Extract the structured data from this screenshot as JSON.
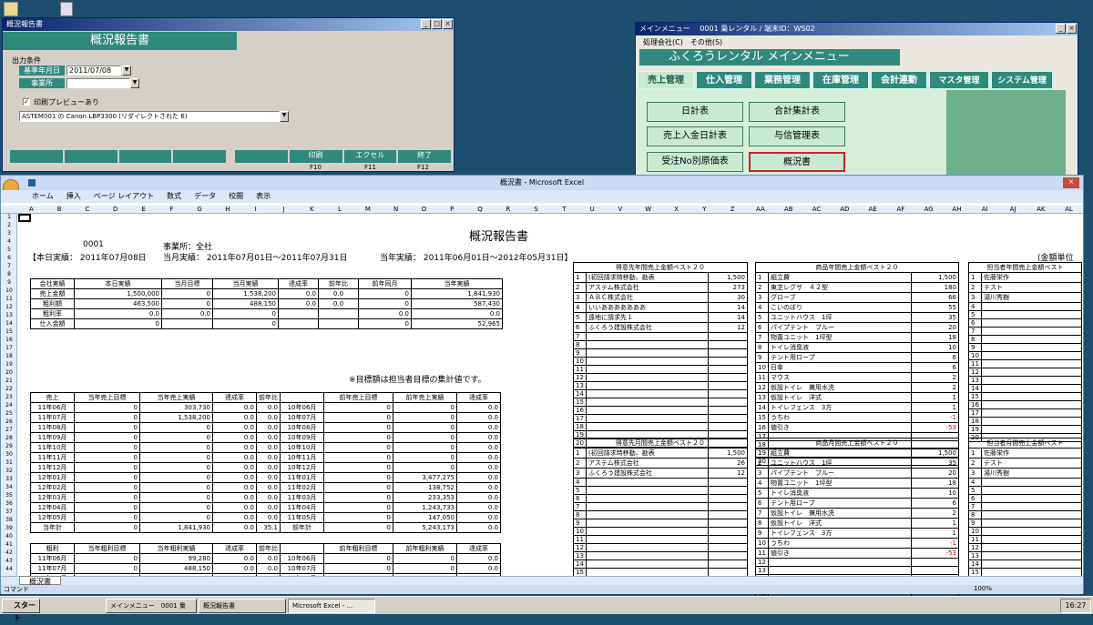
{
  "report_window": {
    "title": "概況報告書",
    "header": "概況報告書",
    "group_label": "出力条件",
    "date_label": "基準年月日",
    "date_value": "2011/07/08",
    "office_label": "事業所",
    "preview_label": "印刷プレビューあり",
    "printer": "ASTEM001 の Canon LBP3300 (リダイレクトされた 6)",
    "btn_print": "印刷",
    "btn_excel": "エクセル",
    "btn_end": "終了",
    "f10": "F10",
    "f11": "F11",
    "f12": "F12"
  },
  "menu_window": {
    "title": "メインメニュー　 0001 梟レンタル / 端末ID：WS02",
    "menu1": "処理会社(C)",
    "menu2": "その他(S)",
    "header": "ふくろうレンタル メインメニュー",
    "tabs": [
      "売上管理",
      "仕入管理",
      "業務管理",
      "在庫管理",
      "会計連動",
      "マスタ管理",
      "システム管理"
    ],
    "buttons": [
      "日計表",
      "合計集計表",
      "売上入金日計表",
      "与信管理表",
      "受注No別原価表",
      "概況書"
    ]
  },
  "excel": {
    "title": "概況書 - Microsoft Excel",
    "ribbon": [
      "ホーム",
      "挿入",
      "ページ レイアウト",
      "数式",
      "データ",
      "校閲",
      "表示"
    ],
    "cell_ref": "A1",
    "sheet_tab": "概況書",
    "status": "コマンド",
    "zoom": "100%",
    "col_heads": [
      "A",
      "B",
      "C",
      "D",
      "E",
      "F",
      "G",
      "H",
      "I",
      "J",
      "K",
      "L",
      "M",
      "N",
      "O",
      "P",
      "Q",
      "R",
      "S",
      "T",
      "U",
      "V",
      "W",
      "X",
      "Y",
      "Z",
      "AA",
      "AB",
      "AC",
      "AD",
      "AE",
      "AF",
      "AG",
      "AH",
      "AI",
      "AJ",
      "AK",
      "AL"
    ],
    "sheet_title": "概況報告書",
    "code": "0001",
    "office": "事業所：全社",
    "honjitsu": "【本日実績： 2011年07月08日",
    "tougetsu": "当月実績： 2011年07月01日～2011年07月31日",
    "tounen": "当年実績： 2011年06月01日～2012年05月31日】",
    "unit": "(金額単位",
    "t1_head": [
      "会社実績",
      "本日実績",
      "当月目標",
      "当月実績",
      "達成率",
      "前年比",
      "前年同月",
      "当年実績"
    ],
    "t1_rows": [
      [
        "売上金額",
        "1,500,000",
        "0",
        "1,538,200",
        "0.0",
        "0.0",
        "0",
        "1,841,930"
      ],
      [
        "粗利額",
        "463,500",
        "0",
        "488,150",
        "0.0",
        "0.0",
        "0",
        "587,430"
      ],
      [
        "粗利率",
        "0.0",
        "0.0",
        "0",
        "",
        "",
        "0.0",
        "0.0"
      ],
      [
        "仕入金額",
        "0",
        "",
        "0",
        "",
        "",
        "0",
        "52,965"
      ]
    ],
    "note": "※目標額は担当者目標の集計値です。",
    "t2_head": [
      "売上",
      "当年売上目標",
      "当年売上実績",
      "達成率",
      "前年比",
      "",
      "前年売上目標",
      "前年売上実績",
      "達成率"
    ],
    "t2_rows": [
      [
        "11年06月",
        "0",
        "303,730",
        "0.0",
        "0.0",
        "10年06月",
        "0",
        "0",
        "0.0"
      ],
      [
        "11年07月",
        "0",
        "1,538,200",
        "0.0",
        "0.0",
        "10年07月",
        "0",
        "0",
        "0.0"
      ],
      [
        "11年08月",
        "0",
        "0",
        "0.0",
        "0.0",
        "10年08月",
        "0",
        "0",
        "0.0"
      ],
      [
        "11年09月",
        "0",
        "0",
        "0.0",
        "0.0",
        "10年09月",
        "0",
        "0",
        "0.0"
      ],
      [
        "11年10月",
        "0",
        "0",
        "0.0",
        "0.0",
        "10年10月",
        "0",
        "0",
        "0.0"
      ],
      [
        "11年11月",
        "0",
        "0",
        "0.0",
        "0.0",
        "10年11月",
        "0",
        "0",
        "0.0"
      ],
      [
        "11年12月",
        "0",
        "0",
        "0.0",
        "0.0",
        "10年12月",
        "0",
        "0",
        "0.0"
      ],
      [
        "12年01月",
        "0",
        "0",
        "0.0",
        "0.0",
        "11年01月",
        "0",
        "3,477,275",
        "0.0"
      ],
      [
        "12年02月",
        "0",
        "0",
        "0.0",
        "0.0",
        "11年02月",
        "0",
        "138,752",
        "0.0"
      ],
      [
        "12年03月",
        "0",
        "0",
        "0.0",
        "0.0",
        "11年03月",
        "0",
        "233,353",
        "0.0"
      ],
      [
        "12年04月",
        "0",
        "0",
        "0.0",
        "0.0",
        "11年04月",
        "0",
        "1,243,733",
        "0.0"
      ],
      [
        "12年05月",
        "0",
        "0",
        "0.0",
        "0.0",
        "11年05月",
        "0",
        "147,050",
        "0.0"
      ]
    ],
    "t2_total": [
      "当年計",
      "0",
      "1,841,930",
      "0.0",
      "35.1",
      "前年計",
      "0",
      "5,243,173",
      "0.0"
    ],
    "t3_head": [
      "粗利",
      "当年粗利目標",
      "当年粗利実績",
      "達成率",
      "前年比",
      "",
      "前年粗利目標",
      "前年粗利実績",
      "達成率"
    ],
    "t3_rows": [
      [
        "11年06月",
        "0",
        "99,280",
        "0.0",
        "0.0",
        "10年06月",
        "0",
        "0",
        "0.0"
      ],
      [
        "11年07月",
        "0",
        "488,150",
        "0.0",
        "0.0",
        "10年07月",
        "0",
        "0",
        "0.0"
      ],
      [
        "11年08月",
        "0",
        "0",
        "0.0",
        "0.0",
        "10年08月",
        "0",
        "0",
        "0.0"
      ]
    ],
    "best1_title": "得意先年間売上金額ベスト２０",
    "best1": [
      [
        "1",
        "(初回請求時移動、勘表",
        "1,500"
      ],
      [
        "2",
        "アステム株式会社",
        "273"
      ],
      [
        "3",
        "ＡＢＣ株式会社",
        "30"
      ],
      [
        "4",
        "いいあああああああ",
        "14"
      ],
      [
        "5",
        "遠地に請求先１",
        "14"
      ],
      [
        "6",
        "ふくろう建設株式会社",
        "12"
      ]
    ],
    "best2_title": "商品年間売上金額ベスト２０",
    "best2": [
      [
        "1",
        "組立費",
        "1,500"
      ],
      [
        "2",
        "東芝レグザ　４２型",
        "180"
      ],
      [
        "3",
        "グローブ",
        "66"
      ],
      [
        "4",
        "こいのぼり",
        "55"
      ],
      [
        "5",
        "ユニットハウス　1坪",
        "35"
      ],
      [
        "6",
        "パイプテント　ブルー",
        "20"
      ],
      [
        "7",
        "物置ユニット　1坪型",
        "18"
      ],
      [
        "8",
        "トイレ消臭液",
        "10"
      ],
      [
        "9",
        "テント用ロープ",
        "6"
      ],
      [
        "10",
        "日傘　",
        "6"
      ],
      [
        "11",
        "マウス",
        "2"
      ],
      [
        "12",
        "仮設トイレ　兼用水洗",
        "2"
      ],
      [
        "13",
        "仮設トイレ　洋式",
        "1"
      ],
      [
        "14",
        "トイレフェンス　3方",
        "1"
      ],
      [
        "15",
        "うちわ",
        "-1"
      ],
      [
        "16",
        "値引き",
        "-53"
      ]
    ],
    "best3_title": "担当者年間売上金額ベスト",
    "best3": [
      [
        "1",
        "佐藤栄作"
      ],
      [
        "2",
        "テスト"
      ],
      [
        "3",
        "湯川秀樹"
      ]
    ],
    "best4_title": "得意先月間売上金額ベスト２０",
    "best4": [
      [
        "1",
        "(初回請求時移動、勘表",
        "1,500"
      ],
      [
        "2",
        "アステム株式会社",
        "26"
      ],
      [
        "3",
        "ふくろう建設株式会社",
        "12"
      ]
    ],
    "best5_title": "商品月間売上金額ベスト２０",
    "best5": [
      [
        "1",
        "組立費",
        "1,500"
      ],
      [
        "2",
        "ユニットハウス　1坪",
        "35"
      ],
      [
        "3",
        "パイプテント　ブルー",
        "20"
      ],
      [
        "4",
        "物置ユニット　1坪型",
        "18"
      ],
      [
        "5",
        "トイレ消臭液",
        "10"
      ],
      [
        "6",
        "テント用ロープ",
        "6"
      ],
      [
        "7",
        "仮設トイレ　兼用水洗",
        "2"
      ],
      [
        "8",
        "仮設トイレ　洋式",
        "1"
      ],
      [
        "9",
        "トイレフェンス　3方",
        "1"
      ],
      [
        "10",
        "うちわ",
        "-1"
      ],
      [
        "11",
        "値引き",
        "-53"
      ]
    ],
    "best6_title": "担当者月間売上金額ベスト",
    "best6": [
      [
        "1",
        "佐藤栄作"
      ],
      [
        "2",
        "テスト"
      ],
      [
        "3",
        "湯川秀樹"
      ]
    ]
  },
  "taskbar": {
    "start": "スタート",
    "items": [
      "メインメニュー　0001 梟レ...",
      "概況報告書",
      "Microsoft Excel - ..."
    ],
    "clock": "16:27"
  }
}
